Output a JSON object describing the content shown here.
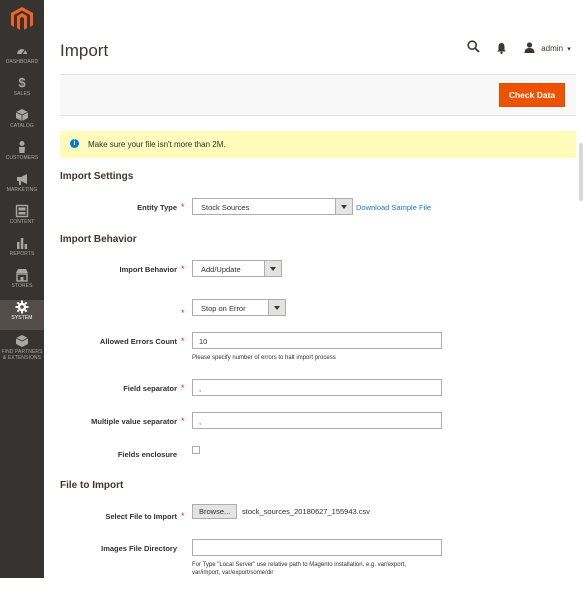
{
  "sidebar": {
    "items": [
      {
        "label": "DASHBOARD",
        "icon": "dashboard-icon"
      },
      {
        "label": "SALES",
        "icon": "dollar-icon"
      },
      {
        "label": "CATALOG",
        "icon": "cube-icon"
      },
      {
        "label": "CUSTOMERS",
        "icon": "person-icon"
      },
      {
        "label": "MARKETING",
        "icon": "megaphone-icon"
      },
      {
        "label": "CONTENT",
        "icon": "layout-icon"
      },
      {
        "label": "REPORTS",
        "icon": "bar-chart-icon"
      },
      {
        "label": "STORES",
        "icon": "storefront-icon"
      },
      {
        "label": "SYSTEM",
        "icon": "gear-icon"
      },
      {
        "label": "FIND PARTNERS",
        "label2": "& EXTENSIONS",
        "icon": "box-icon"
      }
    ],
    "active": "SYSTEM"
  },
  "header": {
    "title": "Import",
    "user": "admin",
    "user_caret": "▾"
  },
  "actions": {
    "check_data": "Check Data"
  },
  "notice": {
    "icon": "i",
    "text": "Make sure your file isn't more than 2M."
  },
  "import_settings": {
    "title": "Import Settings",
    "entity_type_label": "Entity Type",
    "entity_type_value": "Stock Sources",
    "download_link": "Download Sample File"
  },
  "import_behavior": {
    "title": "Import Behavior",
    "behavior_label": "Import Behavior",
    "behavior_value": "Add/Update",
    "on_error_value": "Stop on Error",
    "allowed_errors_label": "Allowed Errors Count",
    "allowed_errors_value": "10",
    "allowed_errors_note": "Please specify number of errors to halt import process",
    "field_separator_label": "Field separator",
    "field_separator_value": ",",
    "multiple_value_separator_label": "Multiple value separator",
    "multiple_value_separator_value": ",",
    "fields_enclosure_label": "Fields enclosure"
  },
  "file_to_import": {
    "title": "File to Import",
    "select_file_label": "Select File to Import",
    "browse_label": "Browse...",
    "file_name": "stock_sources_20180627_155943.csv",
    "images_dir_label": "Images File Directory",
    "images_dir_note_1": "For Type \"Local Server\" use relative path to Magento installation, e.g. var/export,",
    "images_dir_note_2": "var/import, var/export/some/dir"
  },
  "colors": {
    "sidebar_bg": "#373330",
    "accent": "#eb5202",
    "notice_bg": "#fffbbb",
    "link": "#1979c3",
    "required": "#e22626"
  }
}
